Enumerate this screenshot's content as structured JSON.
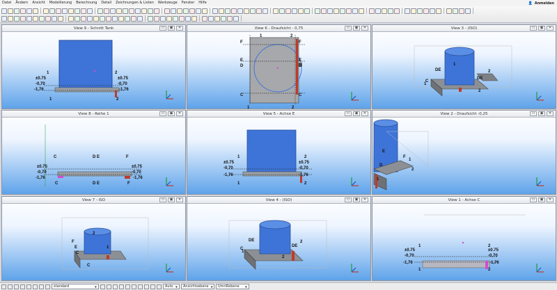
{
  "menu": {
    "items": [
      "Datei",
      "Ändern",
      "Ansicht",
      "Modellierung",
      "Berechnung",
      "Detail",
      "Zeichnungen & Listen",
      "Werkzeuge",
      "Fenster",
      "Hilfe"
    ],
    "account_label": "Anmelden"
  },
  "views": [
    {
      "title": "View 9 - Schnitt Tank"
    },
    {
      "title": "View 6 - Draufsicht - 0,75"
    },
    {
      "title": "View 3 - (ISO)"
    },
    {
      "title": "View 8 - Reihe 1"
    },
    {
      "title": "View 5 - Achse E"
    },
    {
      "title": "View 2 - Draufsicht -0,25"
    },
    {
      "title": "View 7 - ISO"
    },
    {
      "title": "View 4 - (ISO)"
    },
    {
      "title": "View 1 - Achse C"
    }
  ],
  "window_buttons": [
    "▭",
    "▣",
    "✕"
  ],
  "status": {
    "standard_select": "standard",
    "auto_select": "Auto",
    "view_plane_select": "Ansichtsebene",
    "snap_select": "Umrißebene"
  },
  "icons": [
    "grid-icon",
    "axis-icon",
    "select-icon",
    "zoom-icon",
    "rotate-icon",
    "pan-icon",
    "snap-icon",
    "layer-icon"
  ]
}
